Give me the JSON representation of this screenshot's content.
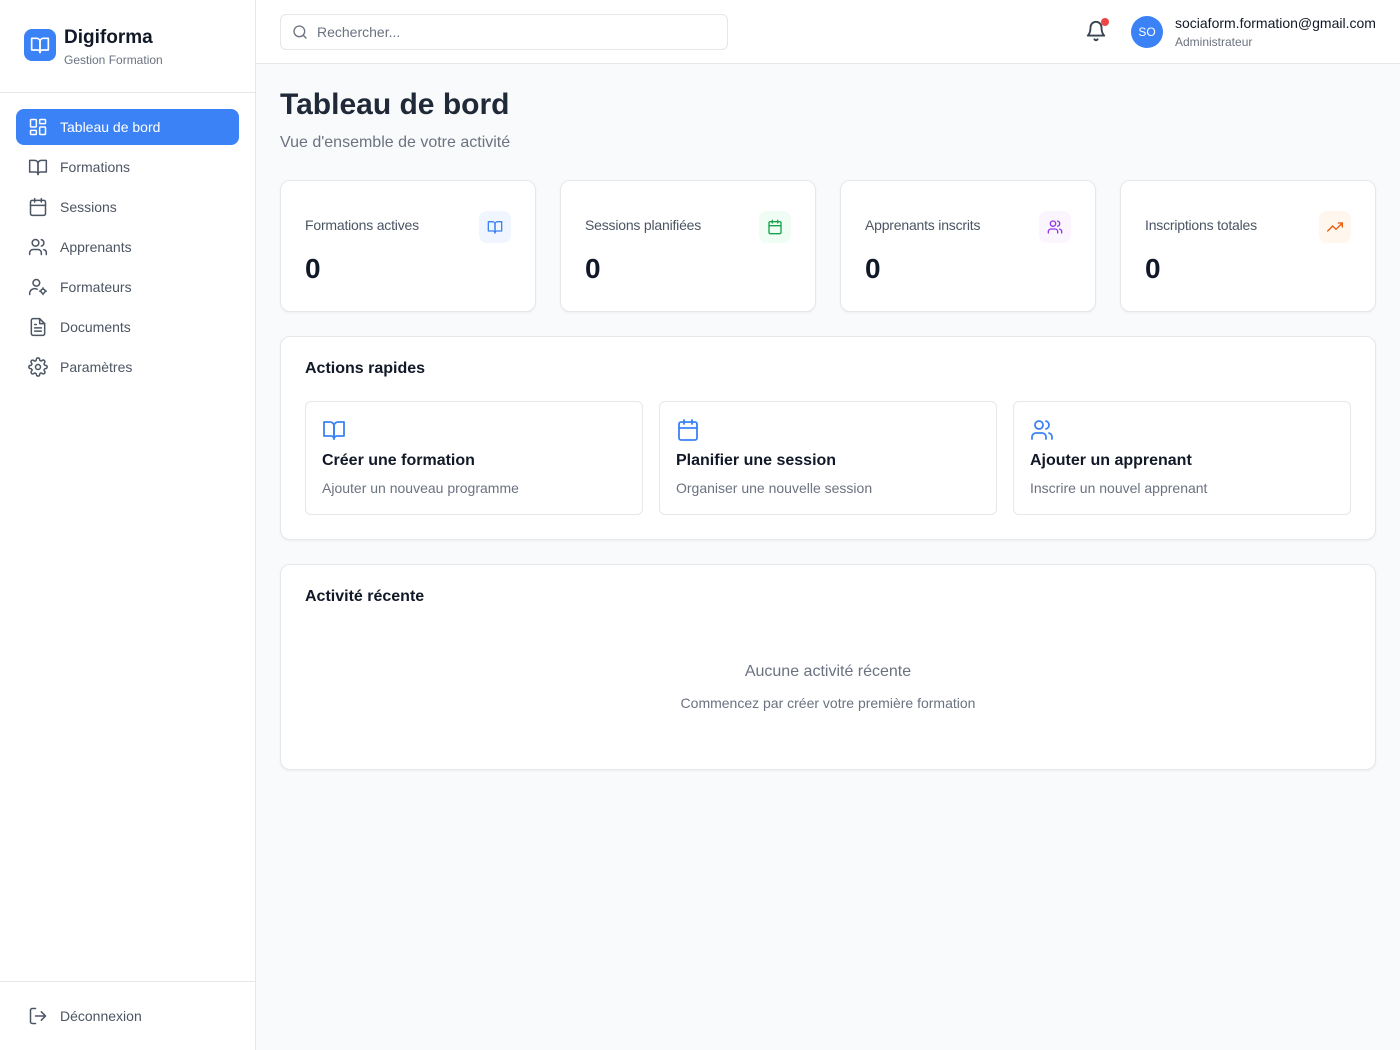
{
  "brand": {
    "name": "Digiforma",
    "subtitle": "Gestion Formation"
  },
  "sidebar": {
    "items": [
      {
        "label": "Tableau de bord",
        "icon": "dashboard-icon",
        "active": true
      },
      {
        "label": "Formations",
        "icon": "book-open-icon"
      },
      {
        "label": "Sessions",
        "icon": "calendar-icon"
      },
      {
        "label": "Apprenants",
        "icon": "users-icon"
      },
      {
        "label": "Formateurs",
        "icon": "user-cog-icon"
      },
      {
        "label": "Documents",
        "icon": "file-text-icon"
      },
      {
        "label": "Paramètres",
        "icon": "settings-icon"
      }
    ],
    "logout_label": "Déconnexion"
  },
  "header": {
    "search_placeholder": "Rechercher...",
    "search_value": "",
    "notification_unread": true,
    "user": {
      "initials": "SO",
      "email": "sociaform.formation@gmail.com",
      "role": "Administrateur"
    }
  },
  "page": {
    "title": "Tableau de bord",
    "subtitle": "Vue d'ensemble de votre activité"
  },
  "stats": [
    {
      "label": "Formations actives",
      "value": "0",
      "icon": "book-open-icon",
      "color": "#3b82f6",
      "bg": "#eff6ff"
    },
    {
      "label": "Sessions planifiées",
      "value": "0",
      "icon": "calendar-icon",
      "color": "#16a34a",
      "bg": "#f0fdf4"
    },
    {
      "label": "Apprenants inscrits",
      "value": "0",
      "icon": "users-icon",
      "color": "#9333ea",
      "bg": "#faf5ff"
    },
    {
      "label": "Inscriptions totales",
      "value": "0",
      "icon": "trending-up-icon",
      "color": "#ea580c",
      "bg": "#fff7ed"
    }
  ],
  "quick_actions": {
    "title": "Actions rapides",
    "items": [
      {
        "title": "Créer une formation",
        "description": "Ajouter un nouveau programme",
        "icon": "book-open-icon"
      },
      {
        "title": "Planifier une session",
        "description": "Organiser une nouvelle session",
        "icon": "calendar-icon"
      },
      {
        "title": "Ajouter un apprenant",
        "description": "Inscrire un nouvel apprenant",
        "icon": "users-icon"
      }
    ]
  },
  "recent_activity": {
    "title": "Activité récente",
    "empty_title": "Aucune activité récente",
    "empty_subtitle": "Commencez par créer votre première formation"
  },
  "colors": {
    "primary": "#3b82f6",
    "notification": "#ef4444"
  }
}
